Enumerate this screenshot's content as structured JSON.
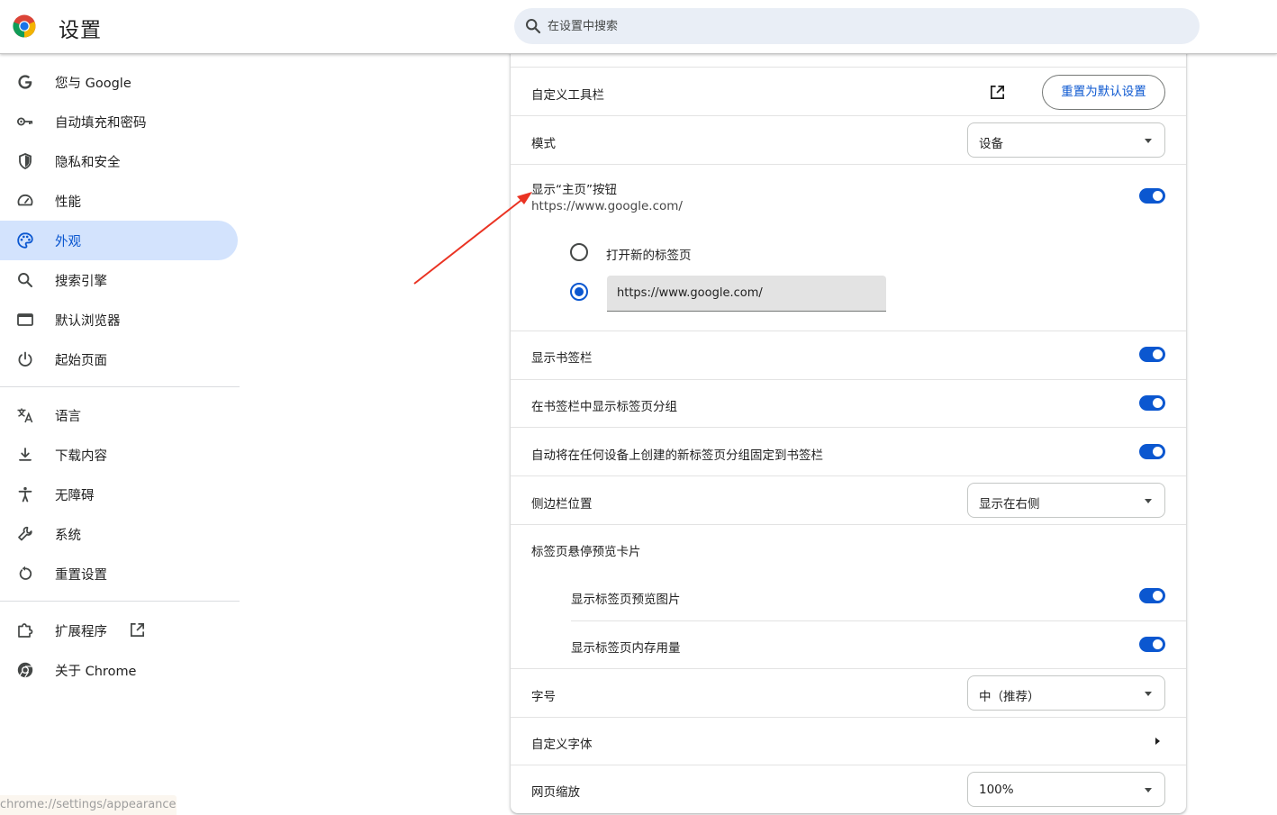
{
  "header": {
    "title": "设置",
    "search_placeholder": "在设置中搜索",
    "logo_icon": "chrome-logo-icon",
    "search_icon": "search-icon"
  },
  "sidebar": {
    "items": [
      {
        "label": "您与 Google",
        "icon": "google-g-icon"
      },
      {
        "label": "自动填充和密码",
        "icon": "key-icon"
      },
      {
        "label": "隐私和安全",
        "icon": "shield-icon"
      },
      {
        "label": "性能",
        "icon": "speedometer-icon"
      },
      {
        "label": "外观",
        "icon": "palette-icon",
        "active": true
      },
      {
        "label": "搜索引擎",
        "icon": "search-icon"
      },
      {
        "label": "默认浏览器",
        "icon": "browser-window-icon"
      },
      {
        "label": "起始页面",
        "icon": "power-icon"
      },
      {
        "label": "语言",
        "icon": "translate-icon"
      },
      {
        "label": "下载内容",
        "icon": "download-icon"
      },
      {
        "label": "无障碍",
        "icon": "accessibility-icon"
      },
      {
        "label": "系统",
        "icon": "wrench-icon"
      },
      {
        "label": "重置设置",
        "icon": "reset-icon"
      },
      {
        "label": "扩展程序",
        "icon": "puzzle-icon"
      },
      {
        "label": "关于 Chrome",
        "icon": "chrome-icon"
      }
    ],
    "status_url": "chrome://settings/appearance"
  },
  "main": {
    "customize_toolbar": {
      "label": "自定义工具栏",
      "reset_button": "重置为默认设置"
    },
    "mode": {
      "label": "模式",
      "value": "设备"
    },
    "home_button": {
      "label": "显示“主页”按钮",
      "sublabel": "https://www.google.com/",
      "enabled": true,
      "option_new_tab": "打开新的标签页",
      "option_url_value": "https://www.google.com/",
      "selected": "url"
    },
    "bookmarks_bar": {
      "label": "显示书签栏",
      "enabled": true
    },
    "tab_groups_in_bookmarks": {
      "label": "在书签栏中显示标签页分组",
      "enabled": true
    },
    "auto_pin_tab_groups": {
      "label": "自动将在任何设备上创建的新标签页分组固定到书签栏",
      "enabled": true
    },
    "side_panel": {
      "label": "侧边栏位置",
      "value": "显示在右侧"
    },
    "hover_card": {
      "label": "标签页悬停预览卡片",
      "preview_image": {
        "label": "显示标签页预览图片",
        "enabled": true
      },
      "memory_usage": {
        "label": "显示标签页内存用量",
        "enabled": true
      }
    },
    "font_size": {
      "label": "字号",
      "value": "中（推荐）"
    },
    "custom_fonts": {
      "label": "自定义字体"
    },
    "page_zoom": {
      "label": "网页缩放",
      "value": "100%"
    }
  },
  "colors": {
    "accent": "#0b57d0",
    "active_nav_bg": "#d3e3fd",
    "search_bg": "#e9eef6",
    "annotation_arrow": "#ea3323"
  }
}
